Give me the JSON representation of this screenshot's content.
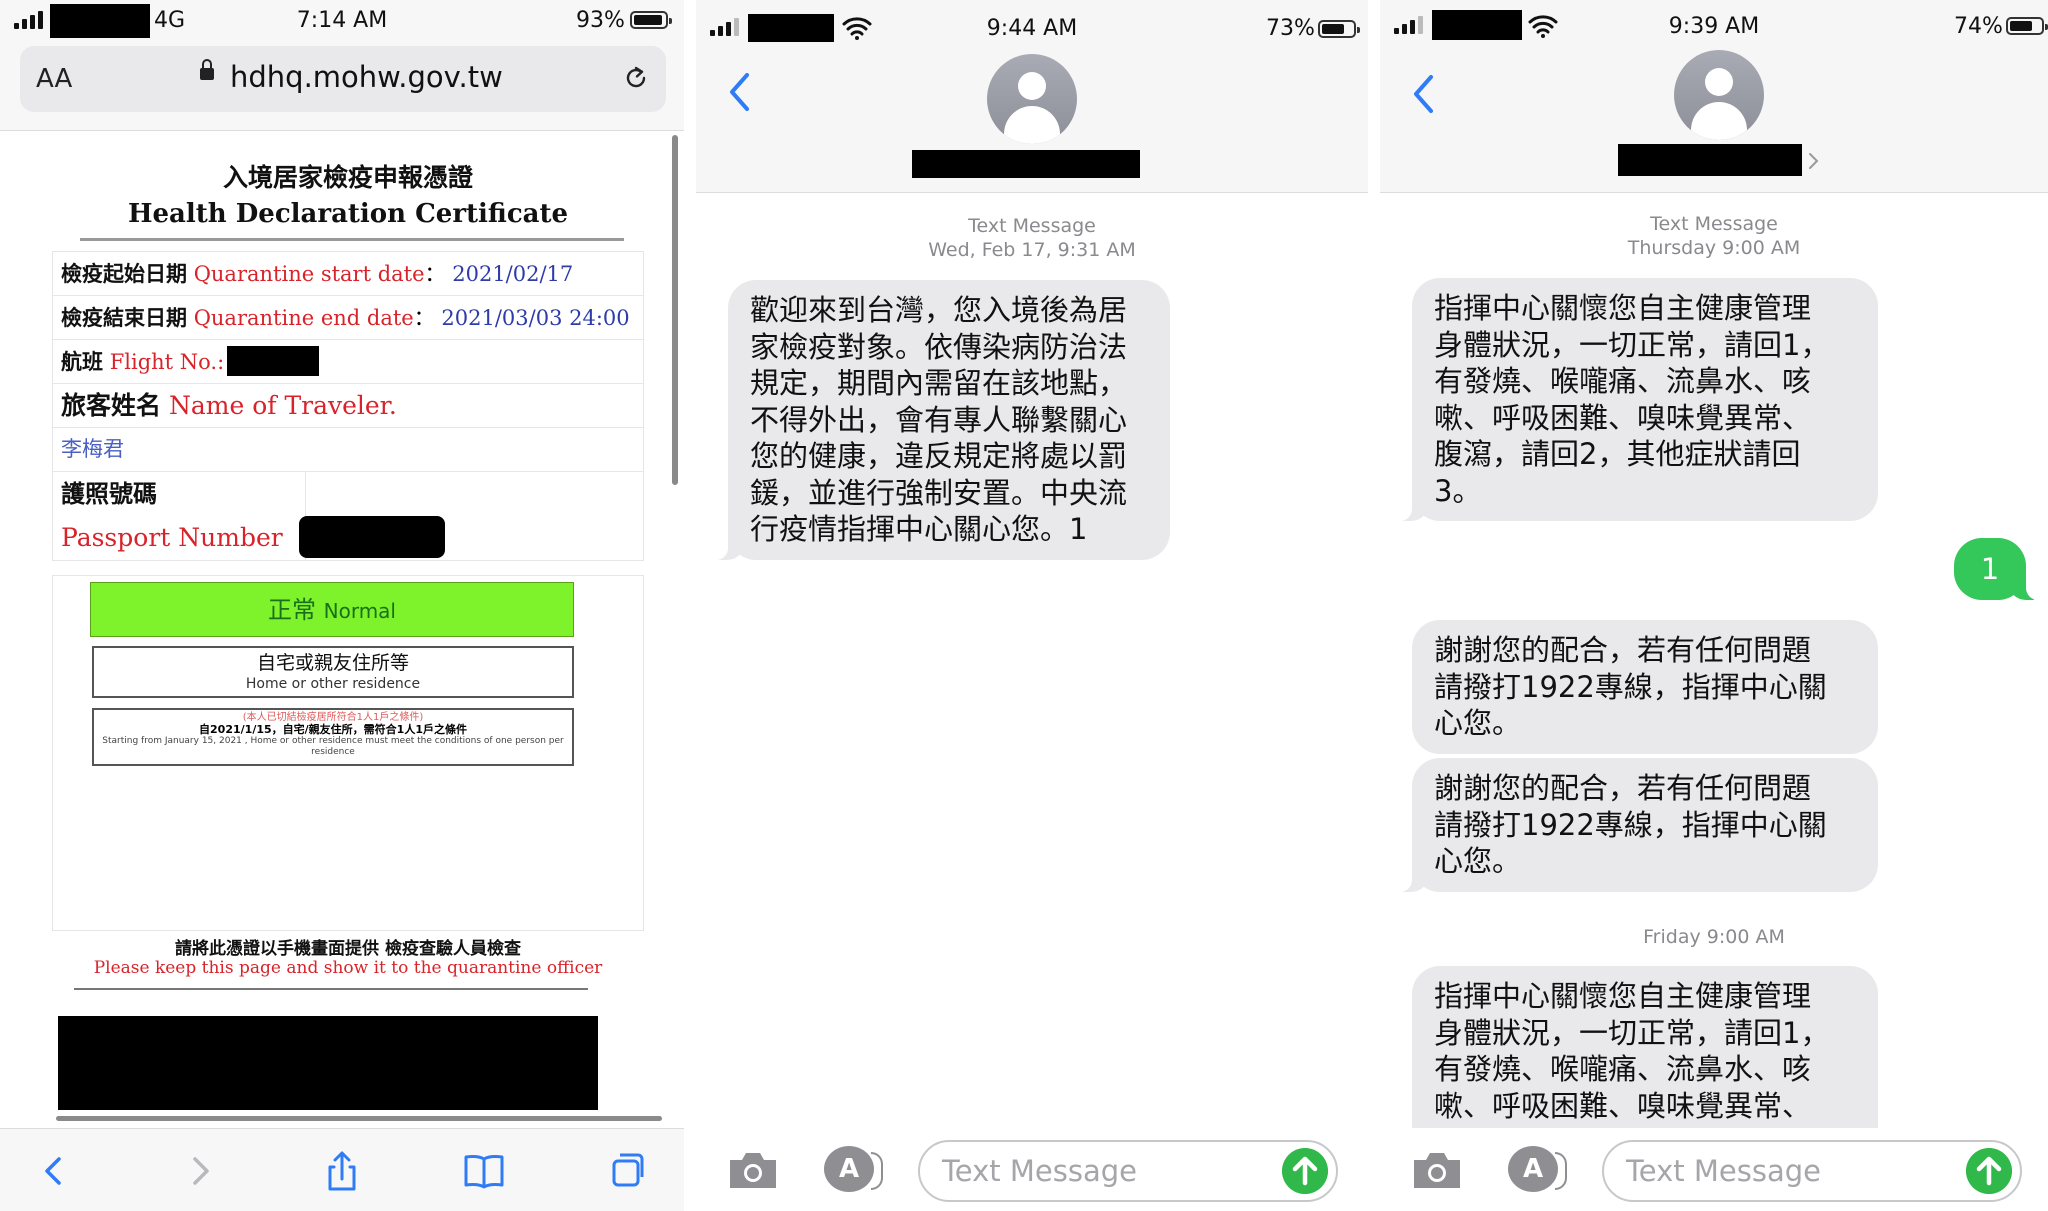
{
  "panel1": {
    "status": {
      "network": "4G",
      "time": "7:14 AM",
      "battery": "93%",
      "battery_level": 0.93
    },
    "address_bar": {
      "text_size": "AA",
      "url": "hdhq.mohw.gov.tw"
    },
    "certificate": {
      "title_zh": "入境居家檢疫申報憑證",
      "title_en": "Health Declaration Certificate",
      "start_label_zh": "檢疫起始日期",
      "start_label_en": "Quarantine start date",
      "colon": "：",
      "start_value": "2021/02/17",
      "end_label_zh": "檢疫結束日期",
      "end_label_en": "Quarantine end date",
      "end_value": "2021/03/03 24:00",
      "flight_label_zh": "航班",
      "flight_label_en": "Flight No.:",
      "traveler_label_zh": "旅客姓名",
      "traveler_label_en": "Name of Traveler.",
      "traveler_name": "李梅君",
      "passport_label_zh": "護照號碼",
      "passport_label_en": "Passport Number",
      "status_zh": "正常",
      "status_en": "Normal",
      "residence_zh": "自宅或親友住所等",
      "residence_en": "Home or other residence",
      "note_red": "(本人已切結檢疫居所符合1人1戶之條件)",
      "note_zh": "自2021/1/15，自宅/親友住所，需符合1人1戶之條件",
      "note_en": "Starting from January 15, 2021 , Home or other residence must meet the conditions of one person per residence",
      "footer_zh": "請將此憑證以手機畫面提供 檢疫查驗人員檢查",
      "footer_en": "Please keep this page and show it to the quarantine officer"
    }
  },
  "panel2": {
    "status": {
      "time": "9:44 AM",
      "battery": "73%",
      "battery_level": 0.73
    },
    "timestamp_line1": "Text Message",
    "timestamp_line2": "Wed, Feb 17, 9:31 AM",
    "messages": [
      {
        "lines": [
          "歡迎來到台灣，您入境後為居",
          "家檢疫對象。依傳染病防治法",
          "規定，期間內需留在該地點，",
          "不得外出，會有專人聯繫關心",
          "您的健康，違反規定將處以罰",
          "鍰，並進行強制安置。中央流",
          "行疫情指揮中心關心您。1"
        ]
      }
    ],
    "composer_placeholder": "Text Message"
  },
  "panel3": {
    "status": {
      "time": "9:39 AM",
      "battery": "74%",
      "battery_level": 0.74
    },
    "timestamp1_line1": "Text Message",
    "timestamp1_line2": "Thursday 9:00 AM",
    "timestamp2": "Friday 9:00 AM",
    "messages": [
      {
        "lines": [
          "指揮中心關懷您自主健康管理",
          "身體狀況，一切正常，請回1，",
          "有發燒、喉嚨痛、流鼻水、咳",
          "嗽、呼吸困難、嗅味覺異常、",
          "腹瀉，請回2，其他症狀請回",
          "3。"
        ]
      },
      {
        "lines": [
          "謝謝您的配合，若有任何問題",
          "請撥打1922專線，指揮中心關",
          "心您。"
        ]
      },
      {
        "lines": [
          "謝謝您的配合，若有任何問題",
          "請撥打1922專線，指揮中心關",
          "心您。"
        ]
      },
      {
        "lines": [
          "指揮中心關懷您自主健康管理",
          "身體狀況，一切正常，請回1，",
          "有發燒、喉嚨痛、流鼻水、咳",
          "嗽、呼吸困難、嗅味覺異常、"
        ]
      }
    ],
    "sent_reply": "1",
    "composer_placeholder": "Text Message"
  },
  "colors": {
    "ios_blue": "#2f7cf6",
    "bubble_gray": "#e9e9eb",
    "sent_green": "#34c759",
    "cert_red": "#d8232a",
    "cert_blue": "#2d3ca8",
    "status_green": "#7ef32b"
  },
  "icons": [
    "signal-icon",
    "wifi-icon",
    "battery-icon",
    "lock-icon",
    "reload-icon",
    "back-chevron-icon",
    "forward-chevron-icon",
    "share-icon",
    "bookmarks-icon",
    "tabs-icon",
    "avatar-icon",
    "camera-icon",
    "app-store-icon",
    "send-arrow-icon"
  ]
}
